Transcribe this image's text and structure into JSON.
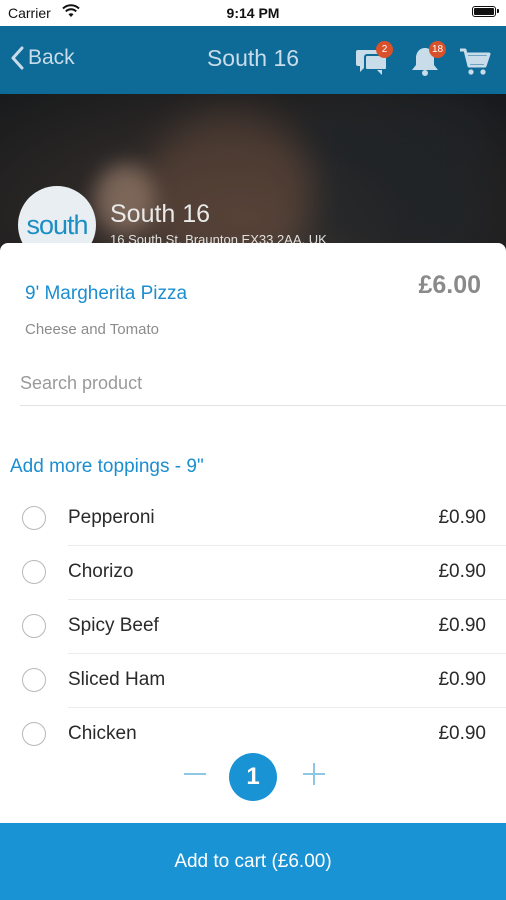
{
  "status_bar": {
    "carrier": "Carrier",
    "time": "9:14 PM"
  },
  "nav": {
    "back_label": "Back",
    "title": "South 16",
    "chat_badge": "2",
    "bell_badge": "18"
  },
  "store": {
    "logo_text": "south",
    "name": "South 16",
    "address": "16 South St, Braunton EX33 2AA, UK"
  },
  "product": {
    "name": "9' Margherita Pizza",
    "price": "£6.00",
    "description": "Cheese and Tomato"
  },
  "search": {
    "placeholder": "Search product"
  },
  "toppings": {
    "title": "Add more toppings - 9\"",
    "items": [
      {
        "name": "Pepperoni",
        "price": "£0.90"
      },
      {
        "name": "Chorizo",
        "price": "£0.90"
      },
      {
        "name": "Spicy Beef",
        "price": "£0.90"
      },
      {
        "name": "Sliced Ham",
        "price": "£0.90"
      },
      {
        "name": "Chicken",
        "price": "£0.90"
      }
    ]
  },
  "quantity": {
    "value": "1"
  },
  "add_to_cart": {
    "label": "Add to cart (£6.00)"
  },
  "colors": {
    "nav_bg": "#0e6a96",
    "accent": "#1993d4",
    "badge": "#d9512a"
  }
}
